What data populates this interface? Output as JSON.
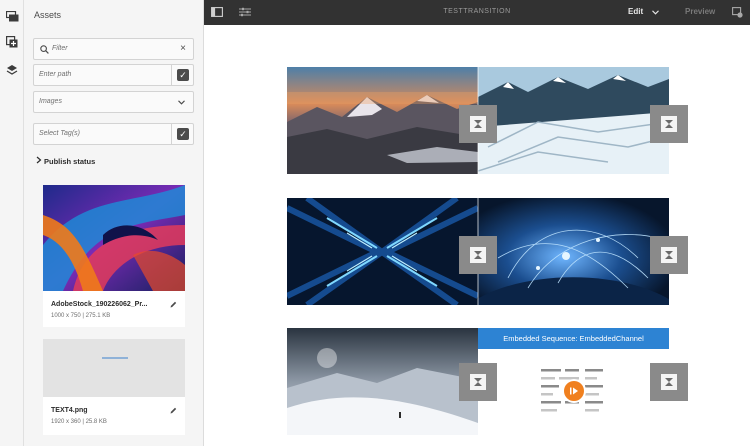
{
  "panel": {
    "title": "Assets",
    "filter_placeholder": "Filter",
    "path_placeholder": "Enter path",
    "type_value": "Images",
    "tags_placeholder": "Select Tag(s)",
    "publish_status": "Publish status"
  },
  "cards": [
    {
      "name": "AdobeStock_190226062_Pr...",
      "meta": "1000 x 750 | 275.1 KB"
    },
    {
      "name": "TEXT4.png",
      "meta": "1920 x 360 | 25.8 KB"
    }
  ],
  "topbar": {
    "title": "TESTTRANSITION",
    "mode": "Edit",
    "preview": "Preview"
  },
  "canvas": {
    "embedded_label": "Embedded Sequence: EmbeddedChannel"
  },
  "colors": {
    "topbar": "#323232",
    "panel": "#f5f5f5",
    "accent": "#2d83d3",
    "play_badge": "#f0801f"
  },
  "icons": [
    "channels-icon",
    "add-asset-icon",
    "layers-icon",
    "toggle-panel-icon",
    "properties-icon",
    "search-icon",
    "close-icon",
    "checkbox-icon",
    "chevron-down-icon",
    "chevron-right-icon",
    "edit-icon",
    "component-placeholder-icon",
    "play-icon",
    "channel-info-icon"
  ]
}
